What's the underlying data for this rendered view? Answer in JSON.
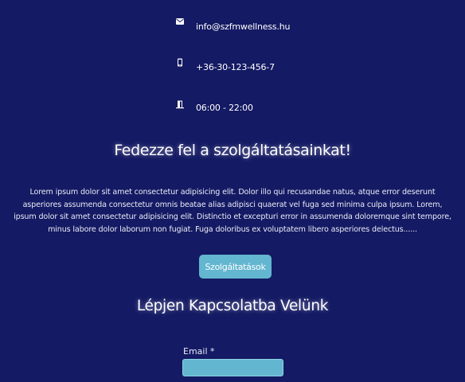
{
  "contact_info": {
    "email": {
      "icon": "envelope-icon",
      "text": "info@szfmwellness.hu"
    },
    "phone": {
      "icon": "mobile-phone-icon",
      "text": "+36-30-123-456-7"
    },
    "hours": {
      "icon": "door-open-icon",
      "text": "06:00 - 22:00"
    }
  },
  "services": {
    "title": "Fedezze fel a szolgáltatásainkat!",
    "description": "Lorem ipsum dolor sit amet consectetur adipisicing elit. Dolor illo qui recusandae natus, atque error deserunt asperiores assumenda consectetur omnis beatae alias adipisci quaerat vel fuga sed minima culpa ipsum. Lorem, ipsum dolor sit amet consectetur adipisicing elit. Distinctio et excepturi error in assumenda doloremque sint tempore, minus labore dolor laborum non fugiat. Fuga doloribus ex voluptatem libero asperiores delectus......",
    "button_label": "Szolgáltatások"
  },
  "contact_form": {
    "title": "Lépjen Kapcsolatba Velünk",
    "email_label": "Email *",
    "email_value": ""
  },
  "colors": {
    "background": "#141a63",
    "accent": "#63b6cf",
    "text": "#ffffff"
  }
}
